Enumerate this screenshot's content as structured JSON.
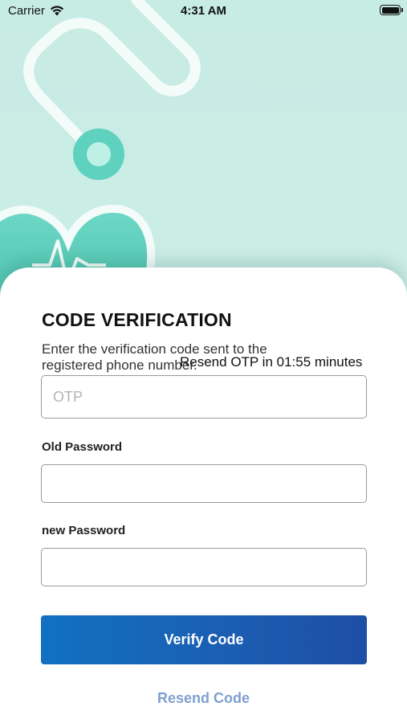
{
  "status_bar": {
    "carrier": "Carrier",
    "time": "4:31 AM",
    "icons": [
      "wifi-icon",
      "battery-icon"
    ]
  },
  "verification": {
    "title": "CODE VERIFICATION",
    "subtitle": "Enter the verification code sent to the registered phone number.",
    "timer_text": "Resend OTP in 01:55 minutes",
    "otp_placeholder": "OTP",
    "otp_value": "",
    "old_password_label": "Old Password",
    "old_password_value": "",
    "new_password_label": "new Password",
    "new_password_value": "",
    "verify_label": "Verify Code",
    "resend_label": "Resend Code"
  },
  "colors": {
    "background": "#c7ece4",
    "decor_teal": "#5fd1bf",
    "button_start": "#1170c2",
    "button_end": "#1e4ea6",
    "resend_link": "#7f9fcf"
  }
}
